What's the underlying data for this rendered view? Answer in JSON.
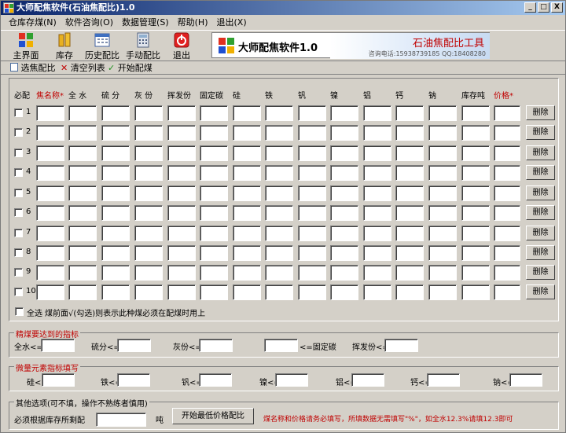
{
  "window": {
    "title": "大师配焦软件(石油焦配比)1.0",
    "controls": {
      "minimize": "_",
      "maximize": "□",
      "close": "X"
    }
  },
  "menu": [
    "仓库存煤(N)",
    "软件咨询(O)",
    "数据管理(S)",
    "帮助(H)",
    "退出(X)"
  ],
  "toolbar": {
    "items": [
      {
        "label": "主界面",
        "icon": "home-grid-icon"
      },
      {
        "label": "库存",
        "icon": "cylinder-stock-icon"
      },
      {
        "label": "历史配比",
        "icon": "calendar-icon"
      },
      {
        "label": "手动配比",
        "icon": "calculator-icon"
      },
      {
        "label": "退出",
        "icon": "power-icon"
      }
    ]
  },
  "banner": {
    "title": "大师配焦软件1.0",
    "right_title": "石油焦配比工具",
    "contact": "咨询电话:15938739185 QQ:18408280"
  },
  "actions": {
    "select": "选焦配比",
    "clear": "清空列表",
    "start": "开始配煤"
  },
  "table": {
    "required_header": "必配",
    "columns": [
      "焦名称*",
      "全 水",
      "硫 分",
      "灰 份",
      "挥发份",
      "固定碳",
      "硅",
      "铁",
      "钒",
      "镍",
      "铝",
      "钙",
      "钠",
      "库存吨",
      "价格*"
    ],
    "rows": [
      "1",
      "2",
      "3",
      "4",
      "5",
      "6",
      "7",
      "8",
      "9",
      "10"
    ],
    "delete_label": "删除",
    "select_all": "全选",
    "note": "煤前面√(勾选)则表示此种煤必须在配煤时用上"
  },
  "target": {
    "title": "精煤要达到的指标",
    "fields": [
      "全水<=",
      "硫分<=",
      "灰份<=",
      "<=固定碳",
      "挥发份<="
    ]
  },
  "trace": {
    "title": "微量元素指标填写",
    "fields": [
      "硅<=",
      "铁<=",
      "钒<=",
      "镍<=",
      "铝<=",
      "钙<=",
      "钠<="
    ]
  },
  "other": {
    "title": "其他选项(可不填，操作不熟练者慎用)",
    "stock_label": "必须根据库存所剩配",
    "unit": "吨",
    "calc_button": "开始最低价格配比",
    "warning": "煤名称和价格请务必填写，所填数据无需填写\"%\"，如全水12.3%请填12.3即可"
  },
  "colors": {
    "title_start": "#0a246a",
    "title_end": "#a6caf0",
    "required_red": "#c00000",
    "background": "#d4d0c8"
  }
}
